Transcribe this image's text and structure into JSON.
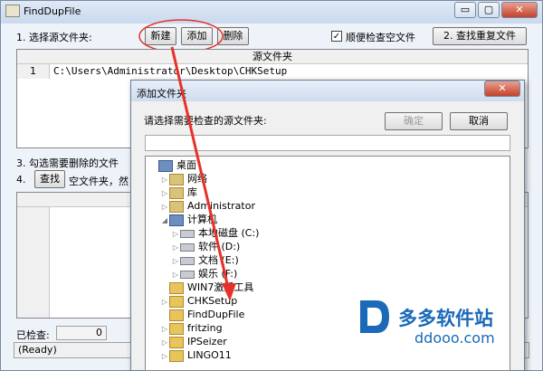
{
  "window": {
    "title": "FindDupFile",
    "min_label": "▭",
    "max_label": "▢",
    "close_label": "✕"
  },
  "main": {
    "step1_label": "1. 选择源文件夹:",
    "btn_new": "新建",
    "btn_add": "添加",
    "btn_delete": "删除",
    "check_empty_label": "顺便检查空文件",
    "check_empty_checked": "✓",
    "btn_find_dup": "2. 查找重复文件",
    "grid": {
      "header": "源文件夹",
      "rows": [
        {
          "num": "1",
          "path": "C:\\Users\\Administrator\\Desktop\\CHKSetup"
        }
      ]
    },
    "step3_label": "3. 勾选需要删除的文件",
    "step4_label": "4.",
    "btn_find": "查找",
    "empty_folder_text": "空文件夹，然",
    "checked_label": "已检查:",
    "checked_value": "0",
    "status_text": "(Ready)"
  },
  "dialog": {
    "title": "添加文件夹",
    "close_label": "✕",
    "prompt": "请选择需要检查的源文件夹:",
    "btn_ok": "确定",
    "btn_cancel": "取消",
    "path_value": "",
    "tree": [
      {
        "label": "桌面",
        "icon": "desktop-icon",
        "level": 0,
        "expander": ""
      },
      {
        "label": "网络",
        "icon": "network-icon",
        "level": 1,
        "expander": "▷"
      },
      {
        "label": "库",
        "icon": "library-icon",
        "level": 1,
        "expander": "▷"
      },
      {
        "label": "Administrator",
        "icon": "user-icon",
        "level": 1,
        "expander": "▷"
      },
      {
        "label": "计算机",
        "icon": "computer-icon",
        "level": 1,
        "expander": "◢"
      },
      {
        "label": "本地磁盘 (C:)",
        "icon": "drive-icon",
        "level": 2,
        "expander": "▷"
      },
      {
        "label": "软件 (D:)",
        "icon": "drive-icon",
        "level": 2,
        "expander": "▷"
      },
      {
        "label": "文档 (E:)",
        "icon": "drive-icon",
        "level": 2,
        "expander": "▷"
      },
      {
        "label": "娱乐 (F:)",
        "icon": "drive-icon",
        "level": 2,
        "expander": "▷"
      },
      {
        "label": "WIN7激活工具",
        "icon": "folder-icon",
        "level": 1,
        "expander": ""
      },
      {
        "label": "CHKSetup",
        "icon": "folder-icon",
        "level": 1,
        "expander": "▷"
      },
      {
        "label": "FindDupFile",
        "icon": "folder-icon",
        "level": 1,
        "expander": ""
      },
      {
        "label": "fritzing",
        "icon": "folder-icon",
        "level": 1,
        "expander": "▷"
      },
      {
        "label": "IPSeizer",
        "icon": "folder-icon",
        "level": 1,
        "expander": "▷"
      },
      {
        "label": "LINGO11",
        "icon": "folder-icon",
        "level": 1,
        "expander": "▷"
      }
    ]
  },
  "watermark": {
    "brand": "多多软件站",
    "url": "ddooo.com"
  },
  "colors": {
    "annotation_red": "#e8302a",
    "watermark_blue": "#1a6ab8"
  }
}
